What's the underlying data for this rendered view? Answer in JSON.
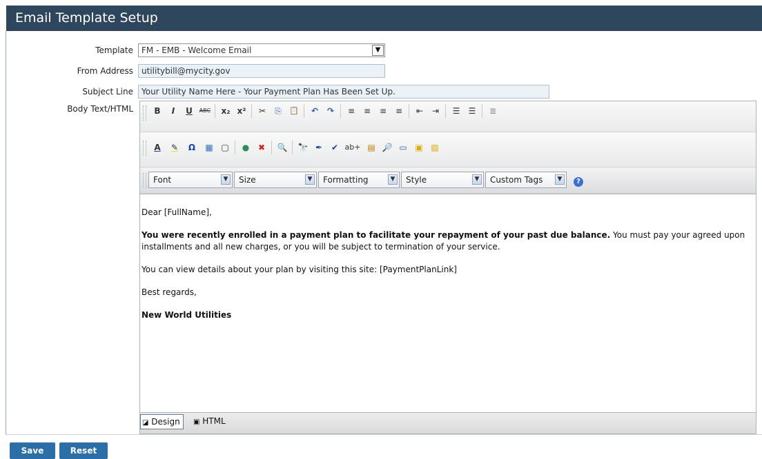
{
  "page": {
    "title": "Email Template Setup"
  },
  "form": {
    "template_label": "Template",
    "template_value": "FM - EMB - Welcome Email",
    "from_label": "From Address",
    "from_value": "utilitybill@mycity.gov",
    "subject_label": "Subject Line",
    "subject_value": "Your Utility Name Here - Your Payment Plan Has Been Set Up.",
    "body_label": "Body Text/HTML"
  },
  "toolbar": {
    "row1": [
      "B",
      "I",
      "U",
      "ABC",
      "x₂",
      "x²",
      "✂",
      "⎘",
      "📋",
      "↶",
      "↷",
      "≡",
      "≡",
      "≡",
      "≡",
      "⇤",
      "⇥",
      "☰",
      "☰",
      "≣"
    ],
    "row2": [
      "A",
      "✎",
      "Ω",
      "▦",
      "▢",
      "●",
      "✖",
      "🔍",
      "🔭",
      "✒",
      "✔",
      "ab+",
      "▤",
      "🔎",
      "▭",
      "▣",
      "▧"
    ],
    "dropdowns": [
      "Font",
      "Size",
      "Formatting",
      "Style",
      "Custom Tags"
    ]
  },
  "body": {
    "greeting": "Dear [FullName],",
    "p1_bold": "You were recently enrolled in a payment plan to facilitate your repayment of your past due balance.",
    "p1_rest": " You must pay your agreed upon installments and all new charges, or you will be subject to termination of your service.",
    "p2": "You can view details about your plan by visiting this site: [PaymentPlanLink]",
    "closing": "Best regards,",
    "signature": "New World Utilities"
  },
  "modes": {
    "design": "Design",
    "html": "HTML"
  },
  "actions": {
    "save": "Save",
    "reset": "Reset"
  },
  "colors": {
    "header": "#2e465b",
    "button": "#2c6ea8",
    "field_bg": "#eaf1f7"
  }
}
